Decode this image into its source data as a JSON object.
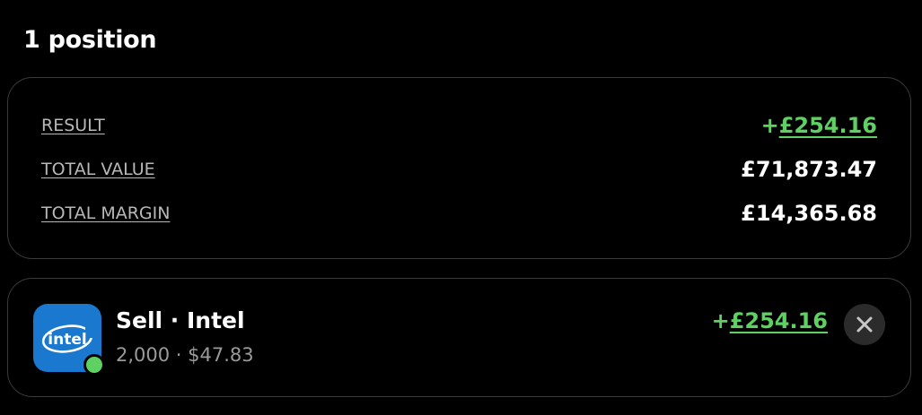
{
  "header": {
    "title": "1 position"
  },
  "summary": {
    "result_label": "RESULT",
    "result_sign": "+",
    "result_value": "£254.16",
    "total_value_label": "TOTAL VALUE",
    "total_value": "£71,873.47",
    "total_margin_label": "TOTAL MARGIN",
    "total_margin": "£14,365.68"
  },
  "position": {
    "title": "Sell · Intel",
    "subtitle": "2,000 · $47.83",
    "result_sign": "+",
    "result_value": "£254.16",
    "logo_text": "intel",
    "logo_icon": "intel-logo",
    "status_icon": "status-dot-icon",
    "close_icon": "close-icon"
  },
  "colors": {
    "background": "#000000",
    "positive": "#5fd062",
    "intel_blue": "#1a78cf",
    "border": "#3a3a3a"
  }
}
